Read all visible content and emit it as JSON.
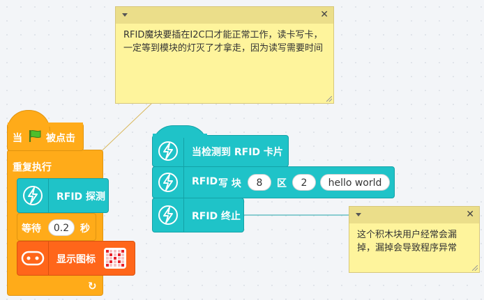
{
  "note_top": {
    "text": "RFID魔块要插在I2C口才能正常工作，读卡写卡，一定等到模块的灯灭了才拿走，因为读写需要时间",
    "close_glyph": "✕",
    "icon": "chevron-down-icon"
  },
  "note_right": {
    "text": "这个积木块用户经常会漏掉，漏掉会导致程序异常",
    "close_glyph": "✕",
    "icon": "chevron-down-icon"
  },
  "script_left": {
    "hat_prefix": "当",
    "hat_suffix": "被点击",
    "repeat_label": "重复执行",
    "rfid_detect_label": "RFID 探测",
    "wait_label": "等待",
    "wait_value": "0.2",
    "wait_unit": "秒",
    "show_icon_label": "显示图标",
    "loop_arrow": "↻"
  },
  "script_right": {
    "hat_label": "当检测到 RFID 卡片",
    "write_rfid": "RFID",
    "write_label": "写 块",
    "block_value": "8",
    "zone_label": "区",
    "zone_value": "2",
    "text_value": "hello world",
    "stop_label": "RFID 终止"
  },
  "colors": {
    "teal": "#1fc3c8",
    "orange": "#ffab19",
    "deep_orange": "#ff661a",
    "note_yellow": "#fef49c"
  }
}
